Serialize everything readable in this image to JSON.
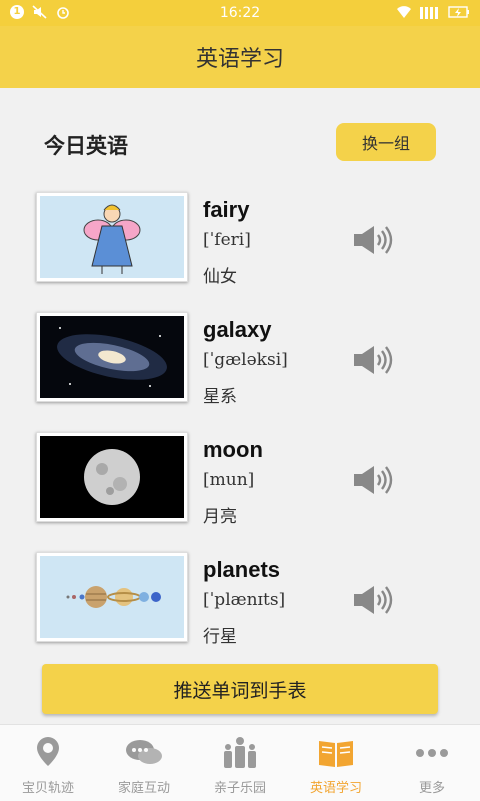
{
  "status_bar": {
    "time": "16:22"
  },
  "header": {
    "title": "英语学习"
  },
  "section": {
    "title": "今日英语",
    "swap_button": "换一组"
  },
  "words": [
    {
      "word": "fairy",
      "phonetic": "[ˈferi]",
      "meaning": "仙女",
      "image": "fairy-image"
    },
    {
      "word": "galaxy",
      "phonetic": "[ˈgæləksi]",
      "meaning": "星系",
      "image": "galaxy-image"
    },
    {
      "word": "moon",
      "phonetic": "[mun]",
      "meaning": "月亮",
      "image": "moon-image"
    },
    {
      "word": "planets",
      "phonetic": "[ˈplænɪts]",
      "meaning": "行星",
      "image": "planets-image"
    }
  ],
  "push_button": "推送单词到手表",
  "tabs": [
    {
      "label": "宝贝轨迹",
      "icon": "location-pin-icon",
      "active": false
    },
    {
      "label": "家庭互动",
      "icon": "chat-bubbles-icon",
      "active": false
    },
    {
      "label": "亲子乐园",
      "icon": "family-icon",
      "active": false
    },
    {
      "label": "英语学习",
      "icon": "book-icon",
      "active": true
    },
    {
      "label": "更多",
      "icon": "more-dots-icon",
      "active": false
    }
  ],
  "colors": {
    "accent": "#f4d24a",
    "active_tab": "#f2a531",
    "inactive_tab": "#9a9a9a"
  }
}
